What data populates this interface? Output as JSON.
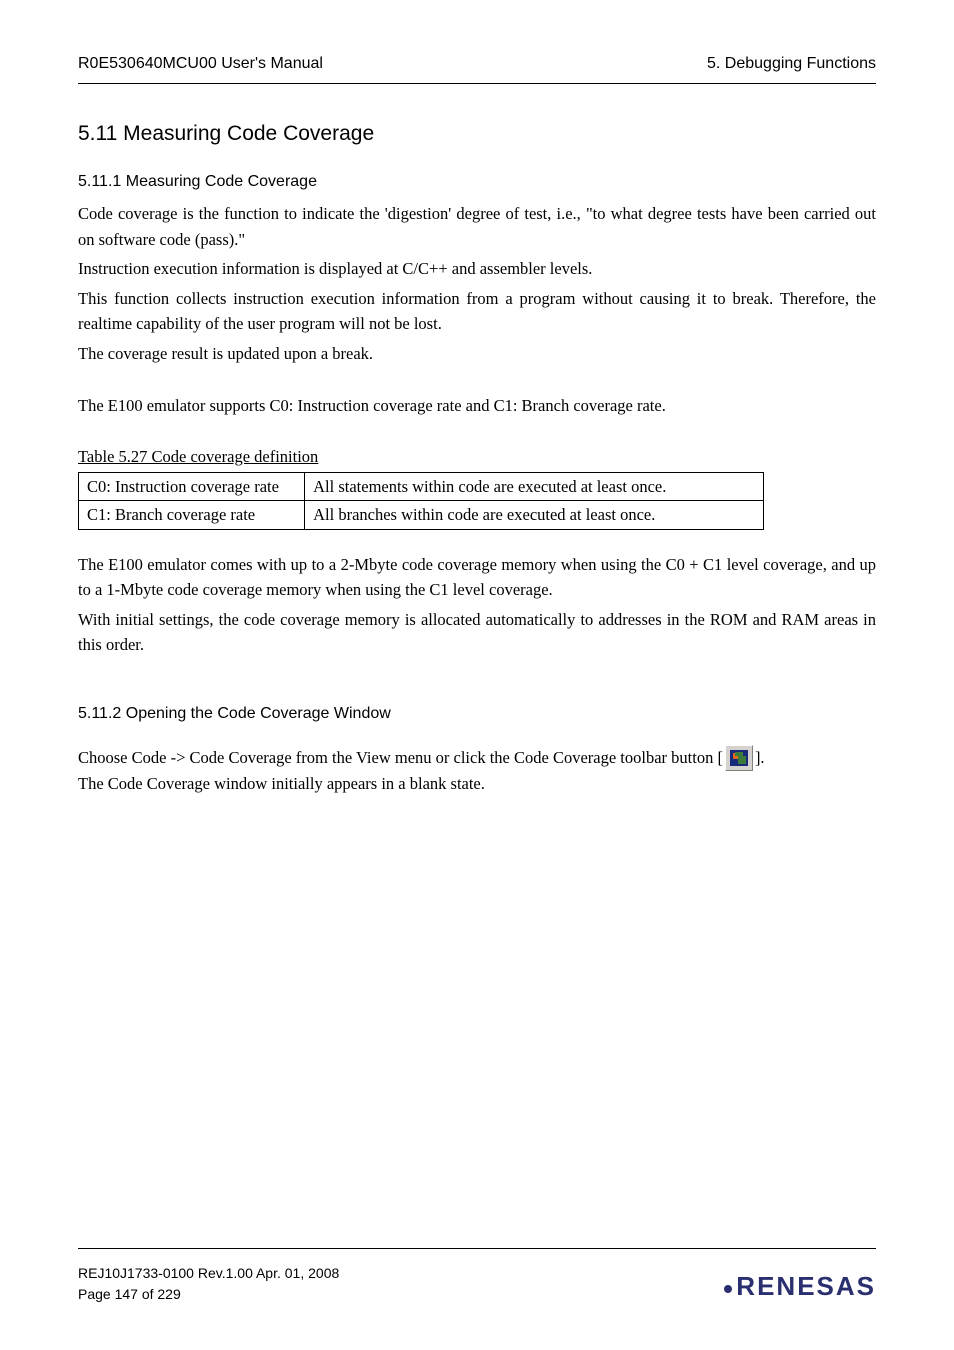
{
  "header": {
    "left": "R0E530640MCU00 User's Manual",
    "right": "5. Debugging Functions"
  },
  "section": {
    "h2": "5.11  Measuring Code Coverage",
    "s1": {
      "heading": "5.11.1   Measuring Code Coverage",
      "p1": "Code coverage is the function to indicate the 'digestion' degree of test, i.e., \"to what degree tests have been carried out on software code (pass).\"",
      "p2": "Instruction execution information is displayed at C/C++ and assembler levels.",
      "p3": "This function collects instruction execution information from a program without causing it to break. Therefore, the realtime capability of the user program will not be lost.",
      "p4": "The coverage result is updated upon a break.",
      "p5": "The E100 emulator supports C0: Instruction coverage rate and C1: Branch coverage rate.",
      "table_caption": "Table 5.27 Code coverage definition",
      "table": {
        "r1c1": "C0: Instruction coverage rate",
        "r1c2": "All statements within code are executed at least once.",
        "r2c1": "C1: Branch coverage rate",
        "r2c2": "All branches within code are executed at least once."
      },
      "p6": "The E100 emulator comes with up to a 2-Mbyte code coverage memory when using the C0 + C1 level coverage, and up to a 1-Mbyte code coverage memory when using the C1 level coverage.",
      "p7": "With initial settings, the code coverage memory is allocated automatically to addresses in the ROM and RAM areas in this order."
    },
    "s2": {
      "heading": "5.11.2   Opening the Code Coverage Window",
      "line1_pre": "Choose Code -> Code Coverage from the View menu or click the Code Coverage toolbar button [",
      "line1_post": "].",
      "p2": "The Code Coverage window initially appears in a blank state."
    }
  },
  "footer": {
    "line1": "REJ10J1733-0100   Rev.1.00    Apr. 01, 2008",
    "line2": "Page 147 of 229",
    "logo": "RENESAS"
  }
}
